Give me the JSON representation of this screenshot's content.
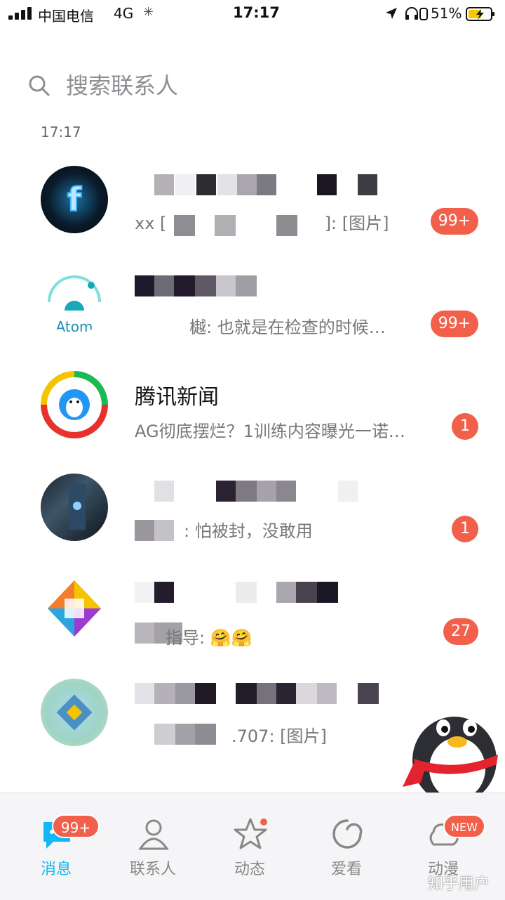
{
  "status_bar": {
    "carrier": "中国电信",
    "network": "4G",
    "time": "17:17",
    "battery_percent": "51%"
  },
  "search": {
    "placeholder": "搜索联系人"
  },
  "time_header": "17:17",
  "conversations": [
    {
      "title": "",
      "preview_prefix": "xx [",
      "preview_suffix": "]: [图片]",
      "badge": "99+"
    },
    {
      "title": "",
      "preview": "樾: 也就是在检查的时候…",
      "badge": "99+",
      "avatar_text": "Atom"
    },
    {
      "title": "腾讯新闻",
      "preview": "AG彻底摆烂？1训练内容曝光一诺…",
      "badge": "1"
    },
    {
      "title": "",
      "preview": ": 怕被封，没敢用",
      "badge": "1"
    },
    {
      "title": "",
      "preview": "指导: 🤗🤗",
      "badge": "27"
    },
    {
      "title": "",
      "preview": ".707: [图片]",
      "badge": ""
    }
  ],
  "tabbar": {
    "tabs": [
      {
        "label": "消息",
        "badge": "99+",
        "active": true
      },
      {
        "label": "联系人"
      },
      {
        "label": "动态"
      },
      {
        "label": "爱看"
      },
      {
        "label": "动漫",
        "badge": "NEW"
      }
    ]
  },
  "watermark": "知乎用户",
  "colors": {
    "accent": "#12b7f5",
    "badge": "#f25f4a"
  }
}
